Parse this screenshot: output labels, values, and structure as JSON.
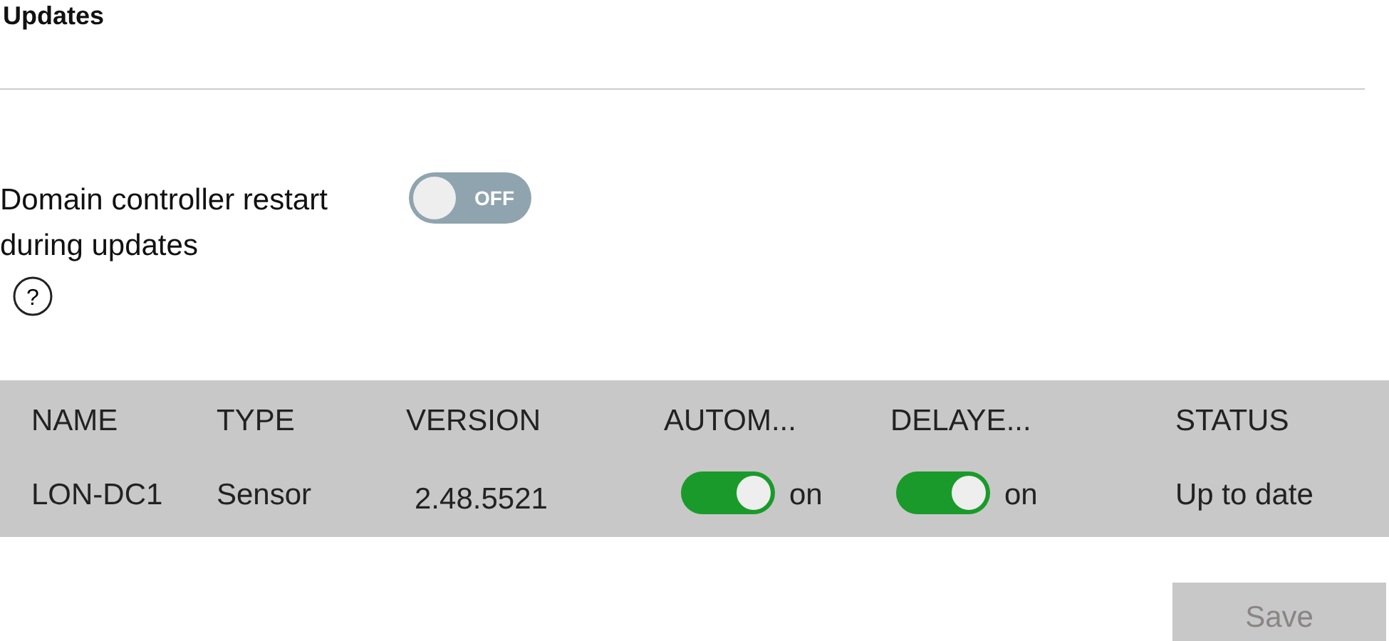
{
  "title": "Updates",
  "restart_setting": {
    "label": "Domain controller restart during updates",
    "help": "?",
    "toggle": {
      "on": false,
      "text": "OFF"
    }
  },
  "table": {
    "columns": [
      "NAME",
      "TYPE",
      "VERSION",
      "AUTOM...",
      "DELAYE...",
      "STATUS"
    ],
    "rows": [
      {
        "name": "LON-DC1",
        "type": "Sensor",
        "version": "2.48.5521",
        "automatic": {
          "on": true,
          "label": "on"
        },
        "delayed": {
          "on": true,
          "label": "on"
        },
        "status": "Up to date"
      }
    ]
  },
  "save_button": {
    "label": "Save",
    "disabled": true
  }
}
